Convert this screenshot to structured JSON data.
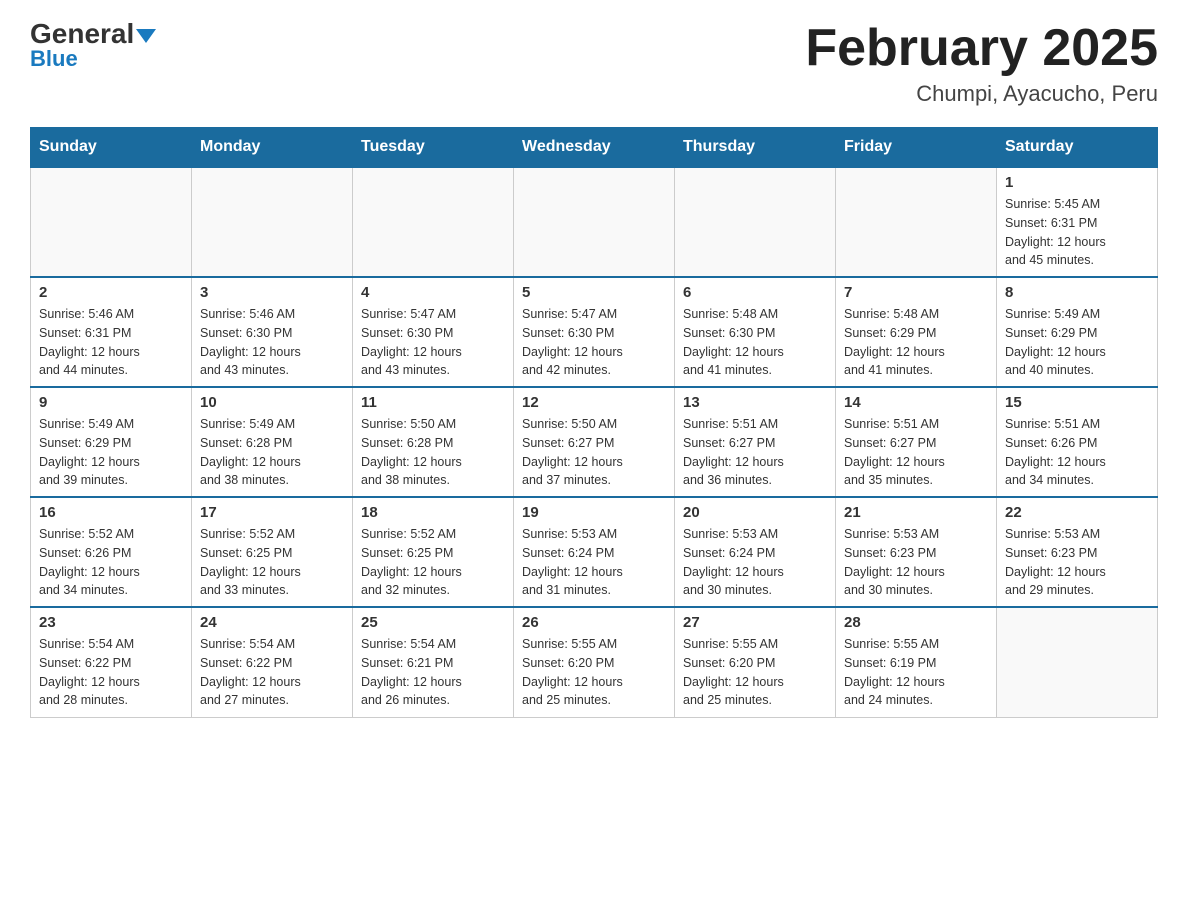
{
  "header": {
    "logo_main": "General",
    "logo_sub": "Blue",
    "month_title": "February 2025",
    "location": "Chumpi, Ayacucho, Peru"
  },
  "weekdays": [
    "Sunday",
    "Monday",
    "Tuesday",
    "Wednesday",
    "Thursday",
    "Friday",
    "Saturday"
  ],
  "weeks": [
    [
      {
        "day": "",
        "info": ""
      },
      {
        "day": "",
        "info": ""
      },
      {
        "day": "",
        "info": ""
      },
      {
        "day": "",
        "info": ""
      },
      {
        "day": "",
        "info": ""
      },
      {
        "day": "",
        "info": ""
      },
      {
        "day": "1",
        "info": "Sunrise: 5:45 AM\nSunset: 6:31 PM\nDaylight: 12 hours\nand 45 minutes."
      }
    ],
    [
      {
        "day": "2",
        "info": "Sunrise: 5:46 AM\nSunset: 6:31 PM\nDaylight: 12 hours\nand 44 minutes."
      },
      {
        "day": "3",
        "info": "Sunrise: 5:46 AM\nSunset: 6:30 PM\nDaylight: 12 hours\nand 43 minutes."
      },
      {
        "day": "4",
        "info": "Sunrise: 5:47 AM\nSunset: 6:30 PM\nDaylight: 12 hours\nand 43 minutes."
      },
      {
        "day": "5",
        "info": "Sunrise: 5:47 AM\nSunset: 6:30 PM\nDaylight: 12 hours\nand 42 minutes."
      },
      {
        "day": "6",
        "info": "Sunrise: 5:48 AM\nSunset: 6:30 PM\nDaylight: 12 hours\nand 41 minutes."
      },
      {
        "day": "7",
        "info": "Sunrise: 5:48 AM\nSunset: 6:29 PM\nDaylight: 12 hours\nand 41 minutes."
      },
      {
        "day": "8",
        "info": "Sunrise: 5:49 AM\nSunset: 6:29 PM\nDaylight: 12 hours\nand 40 minutes."
      }
    ],
    [
      {
        "day": "9",
        "info": "Sunrise: 5:49 AM\nSunset: 6:29 PM\nDaylight: 12 hours\nand 39 minutes."
      },
      {
        "day": "10",
        "info": "Sunrise: 5:49 AM\nSunset: 6:28 PM\nDaylight: 12 hours\nand 38 minutes."
      },
      {
        "day": "11",
        "info": "Sunrise: 5:50 AM\nSunset: 6:28 PM\nDaylight: 12 hours\nand 38 minutes."
      },
      {
        "day": "12",
        "info": "Sunrise: 5:50 AM\nSunset: 6:27 PM\nDaylight: 12 hours\nand 37 minutes."
      },
      {
        "day": "13",
        "info": "Sunrise: 5:51 AM\nSunset: 6:27 PM\nDaylight: 12 hours\nand 36 minutes."
      },
      {
        "day": "14",
        "info": "Sunrise: 5:51 AM\nSunset: 6:27 PM\nDaylight: 12 hours\nand 35 minutes."
      },
      {
        "day": "15",
        "info": "Sunrise: 5:51 AM\nSunset: 6:26 PM\nDaylight: 12 hours\nand 34 minutes."
      }
    ],
    [
      {
        "day": "16",
        "info": "Sunrise: 5:52 AM\nSunset: 6:26 PM\nDaylight: 12 hours\nand 34 minutes."
      },
      {
        "day": "17",
        "info": "Sunrise: 5:52 AM\nSunset: 6:25 PM\nDaylight: 12 hours\nand 33 minutes."
      },
      {
        "day": "18",
        "info": "Sunrise: 5:52 AM\nSunset: 6:25 PM\nDaylight: 12 hours\nand 32 minutes."
      },
      {
        "day": "19",
        "info": "Sunrise: 5:53 AM\nSunset: 6:24 PM\nDaylight: 12 hours\nand 31 minutes."
      },
      {
        "day": "20",
        "info": "Sunrise: 5:53 AM\nSunset: 6:24 PM\nDaylight: 12 hours\nand 30 minutes."
      },
      {
        "day": "21",
        "info": "Sunrise: 5:53 AM\nSunset: 6:23 PM\nDaylight: 12 hours\nand 30 minutes."
      },
      {
        "day": "22",
        "info": "Sunrise: 5:53 AM\nSunset: 6:23 PM\nDaylight: 12 hours\nand 29 minutes."
      }
    ],
    [
      {
        "day": "23",
        "info": "Sunrise: 5:54 AM\nSunset: 6:22 PM\nDaylight: 12 hours\nand 28 minutes."
      },
      {
        "day": "24",
        "info": "Sunrise: 5:54 AM\nSunset: 6:22 PM\nDaylight: 12 hours\nand 27 minutes."
      },
      {
        "day": "25",
        "info": "Sunrise: 5:54 AM\nSunset: 6:21 PM\nDaylight: 12 hours\nand 26 minutes."
      },
      {
        "day": "26",
        "info": "Sunrise: 5:55 AM\nSunset: 6:20 PM\nDaylight: 12 hours\nand 25 minutes."
      },
      {
        "day": "27",
        "info": "Sunrise: 5:55 AM\nSunset: 6:20 PM\nDaylight: 12 hours\nand 25 minutes."
      },
      {
        "day": "28",
        "info": "Sunrise: 5:55 AM\nSunset: 6:19 PM\nDaylight: 12 hours\nand 24 minutes."
      },
      {
        "day": "",
        "info": ""
      }
    ]
  ]
}
